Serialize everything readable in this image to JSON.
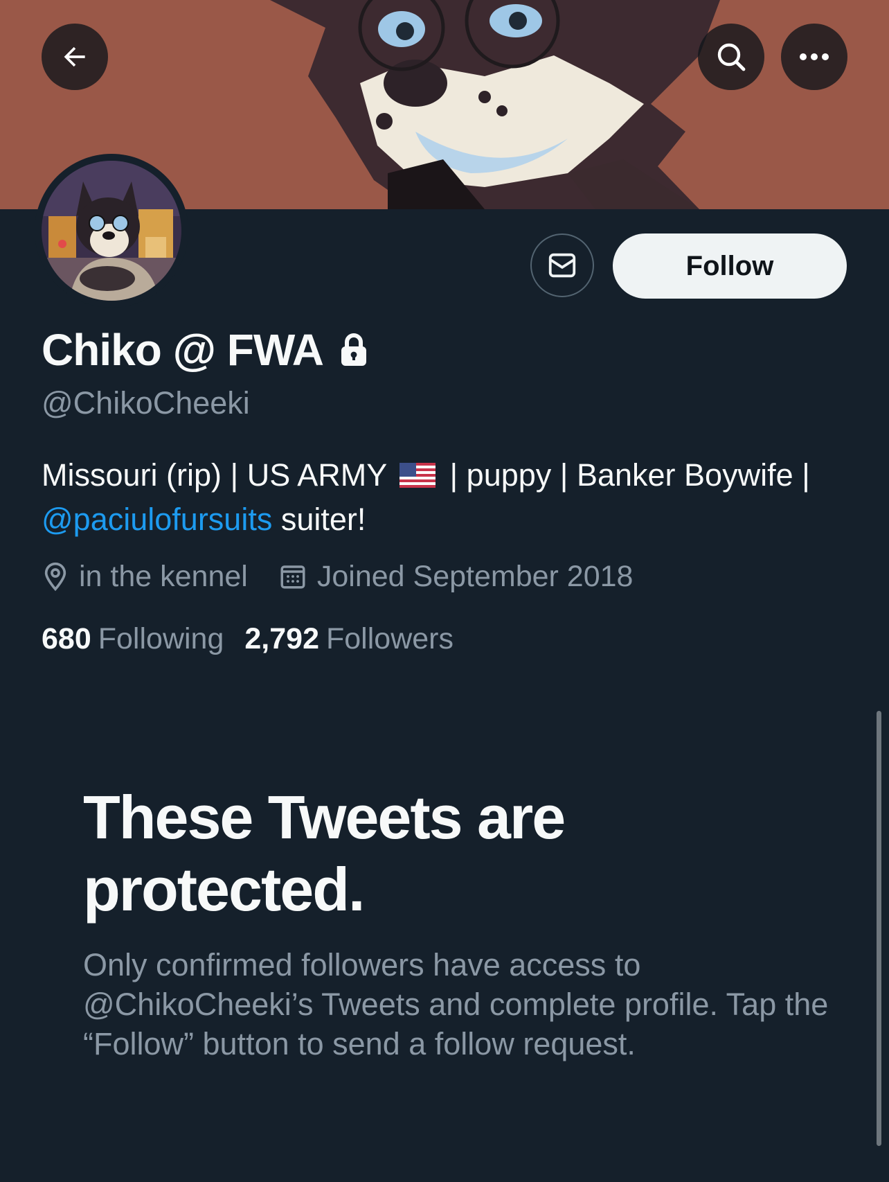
{
  "header": {
    "back_icon": "arrow-left-icon",
    "search_icon": "search-icon",
    "more_icon": "more-horizontal-icon"
  },
  "profile": {
    "display_name": "Chiko @ FWA",
    "lock_icon": "lock-icon",
    "handle": "@ChikoCheeki",
    "bio_line1": "Missouri (rip) | US ARMY",
    "bio_line1_after_flag": "| puppy | Banker Boywife |",
    "bio_mention": "@paciulofursuits",
    "bio_suffix": " suiter!",
    "location": "in the kennel",
    "joined": "Joined September 2018",
    "following_count": "680",
    "following_label": "Following",
    "followers_count": "2,792",
    "followers_label": "Followers"
  },
  "actions": {
    "message_icon": "mail-icon",
    "follow_label": "Follow"
  },
  "protected": {
    "title": "These Tweets are protected.",
    "body": "Only confirmed followers have access to @ChikoCheeki’s Tweets and complete profile. Tap the “Follow” button to send a follow request."
  },
  "colors": {
    "background": "#15202b",
    "accent": "#1d9bf0",
    "secondary_text": "#8b98a5",
    "banner": "#9a5848"
  }
}
